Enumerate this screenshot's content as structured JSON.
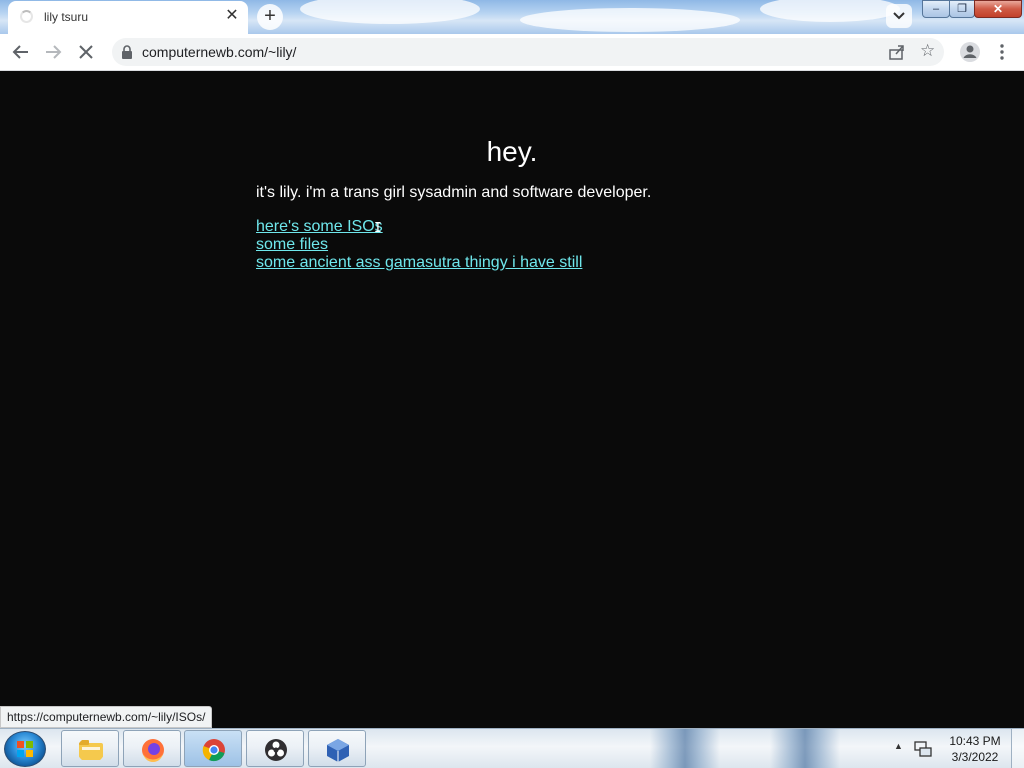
{
  "browser": {
    "tab": {
      "title": "lily tsuru",
      "close_glyph": "✕"
    },
    "new_tab_glyph": "+",
    "url": "computernewb.com/~lily/",
    "window_controls": {
      "minimize": "‒",
      "maximize": "❐",
      "close": "✕"
    }
  },
  "page": {
    "heading": "hey.",
    "intro": "it's lily. i'm a trans girl sysadmin and software developer.",
    "links": [
      {
        "label": "here's some ISOs"
      },
      {
        "label": "some files"
      },
      {
        "label": "some ancient ass gamasutra thingy i have still"
      }
    ],
    "link_color": "#6fe7ec",
    "background_color": "#0a0a0a"
  },
  "status_bubble": "https://computernewb.com/~lily/ISOs/",
  "taskbar": {
    "apps": [
      {
        "name": "file-explorer-icon"
      },
      {
        "name": "firefox-icon"
      },
      {
        "name": "chrome-icon",
        "active": true
      },
      {
        "name": "obs-icon"
      },
      {
        "name": "virtualbox-icon"
      }
    ],
    "clock": {
      "time": "10:43 PM",
      "date": "3/3/2022"
    }
  }
}
